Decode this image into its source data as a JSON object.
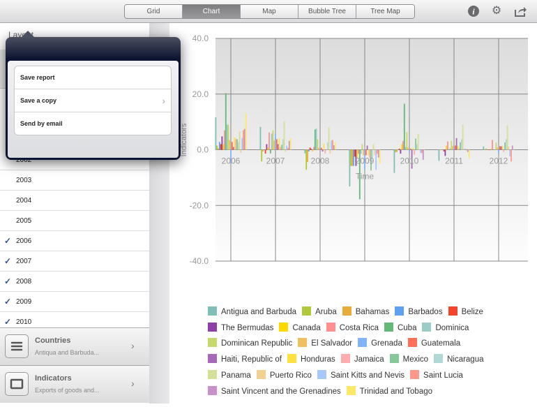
{
  "toolbar": {
    "tabs": [
      "Grid",
      "Chart",
      "Map",
      "Bubble Tree",
      "Tree Map"
    ],
    "selected": "Chart",
    "icons": [
      "info-icon",
      "gear-icon",
      "share-icon"
    ]
  },
  "sidebar": {
    "title": "Layout",
    "years": [
      {
        "label": "2002",
        "checked": false
      },
      {
        "label": "2003",
        "checked": false
      },
      {
        "label": "2004",
        "checked": false
      },
      {
        "label": "2005",
        "checked": false
      },
      {
        "label": "2006",
        "checked": true
      },
      {
        "label": "2007",
        "checked": true
      },
      {
        "label": "2008",
        "checked": true
      },
      {
        "label": "2009",
        "checked": true
      },
      {
        "label": "2010",
        "checked": true
      }
    ],
    "panels": [
      {
        "title": "Countries",
        "subtitle": "Antiqua and Barbuda..."
      },
      {
        "title": "Indicators",
        "subtitle": "Exports of goods and..."
      }
    ]
  },
  "popover": {
    "items": [
      "Save report",
      "Save a copy",
      "Send by email"
    ]
  },
  "chart_data": {
    "type": "bar",
    "xlabel": "Time",
    "ylabel": "Indicators",
    "ylim": [
      -40,
      40
    ],
    "yticks": [
      "40.0",
      "20.0",
      "0.0",
      "-20.0",
      "-40.0"
    ],
    "grid": true,
    "legend_placement": "bottom",
    "categories": [
      "2006",
      "2007",
      "2008",
      "2009",
      "2010",
      "2011",
      "2012"
    ],
    "series": [
      {
        "name": "Antigua and Barbuda",
        "color": "#7fbfb8",
        "values": [
          11.7,
          8.2,
          -1.3,
          -13.2,
          -8.3,
          -4,
          1.2
        ]
      },
      {
        "name": "Aruba",
        "color": "#b2c83c",
        "values": [
          1.5,
          -4.2,
          -7.2,
          -5.8,
          -0.9,
          0,
          0
        ]
      },
      {
        "name": "Bahamas",
        "color": "#e8ac3a",
        "values": [
          0.5,
          -0.6,
          -4.4,
          -5.8,
          -0.8,
          0,
          0.4
        ]
      },
      {
        "name": "Barbados",
        "color": "#5fa0f0",
        "values": [
          2.8,
          0,
          -0.6,
          -5.8,
          0,
          0,
          0
        ]
      },
      {
        "name": "Belize",
        "color": "#f2452c",
        "values": [
          2,
          -1.4,
          0.8,
          -2.5,
          0.4,
          -0.6,
          0
        ]
      },
      {
        "name": "The Bermudas",
        "color": "#8e3fa8",
        "values": [
          4.8,
          2,
          0.3,
          -5.8,
          -1.4,
          -2.2,
          0
        ]
      },
      {
        "name": "Canada",
        "color": "#ffd800",
        "values": [
          2,
          0.8,
          -0.6,
          -2.8,
          2,
          1.5,
          0.4
        ]
      },
      {
        "name": "Costa Rica",
        "color": "#ff9090",
        "values": [
          7,
          6.2,
          1,
          -1.5,
          3.2,
          3,
          3.5
        ]
      },
      {
        "name": "Cuba",
        "color": "#64b878",
        "values": [
          20.3,
          -1.3,
          7.3,
          -17.8,
          16.5,
          0,
          0
        ]
      },
      {
        "name": "Dominica",
        "color": "#9cccc8",
        "values": [
          9,
          5.8,
          7.7,
          -1.5,
          1,
          0.5,
          0
        ]
      },
      {
        "name": "Dominican Republic",
        "color": "#c6d86c",
        "values": [
          9,
          7,
          3.8,
          2,
          6.3,
          3.2,
          2.6
        ]
      },
      {
        "name": "El Salvador",
        "color": "#f0c060",
        "values": [
          3.5,
          3.3,
          0.7,
          -2,
          0.8,
          1.3,
          0.8
        ]
      },
      {
        "name": "Grenada",
        "color": "#80b4f4",
        "values": [
          -5,
          5.7,
          0.6,
          -7,
          -1,
          0.7,
          -1.4
        ]
      },
      {
        "name": "Guatemala",
        "color": "#ff6e58",
        "values": [
          2.8,
          3.8,
          0.7,
          -2,
          0.4,
          1.5,
          1.3
        ]
      },
      {
        "name": "Haiti, Republic of",
        "color": "#a868b8",
        "values": [
          1,
          2,
          -0.6,
          1.5,
          -6.8,
          4.2,
          1.2
        ]
      },
      {
        "name": "Honduras",
        "color": "#ffe040",
        "values": [
          4.4,
          4.1,
          2.2,
          -2,
          0.7,
          1.4,
          1.4
        ]
      },
      {
        "name": "Jamaica",
        "color": "#ffacac",
        "values": [
          3.8,
          1,
          -1.3,
          -3,
          -1.8,
          0.5,
          -0.8
        ]
      },
      {
        "name": "Mexico",
        "color": "#88c898",
        "values": [
          3.8,
          1.8,
          0,
          -7.5,
          4,
          2.7,
          2.6
        ]
      },
      {
        "name": "Nicaragua",
        "color": "#b0d8d4",
        "values": [
          2.8,
          3.8,
          2.7,
          -3,
          2,
          3.8,
          3.8
        ]
      },
      {
        "name": "Panama",
        "color": "#d4e098",
        "values": [
          6.5,
          10.2,
          8.1,
          2,
          5.6,
          9,
          8.8
        ]
      },
      {
        "name": "Puerto Rico",
        "color": "#f4d090",
        "values": [
          -1.1,
          -0.7,
          -1.3,
          -2,
          0,
          0.3,
          1.2
        ]
      },
      {
        "name": "Saint Kitts and Nevis",
        "color": "#a8c8fc",
        "values": [
          4.2,
          1.5,
          3.3,
          -7.2,
          -1.2,
          0.4,
          -2.4
        ]
      },
      {
        "name": "Saint Lucia",
        "color": "#ff9888",
        "values": [
          7,
          0.7,
          3.5,
          -1.5,
          -1.2,
          0.2,
          -4.2
        ]
      },
      {
        "name": "Saint Vincent and the Grenadines",
        "color": "#c890cc",
        "values": [
          7.5,
          3.2,
          1.6,
          -2.8,
          -3.6,
          -0.8,
          1.5
        ]
      },
      {
        "name": "Trinidad and Tobago",
        "color": "#ffe868",
        "values": [
          13,
          4.1,
          2.8,
          -5,
          0,
          -3.2,
          0
        ]
      }
    ]
  }
}
